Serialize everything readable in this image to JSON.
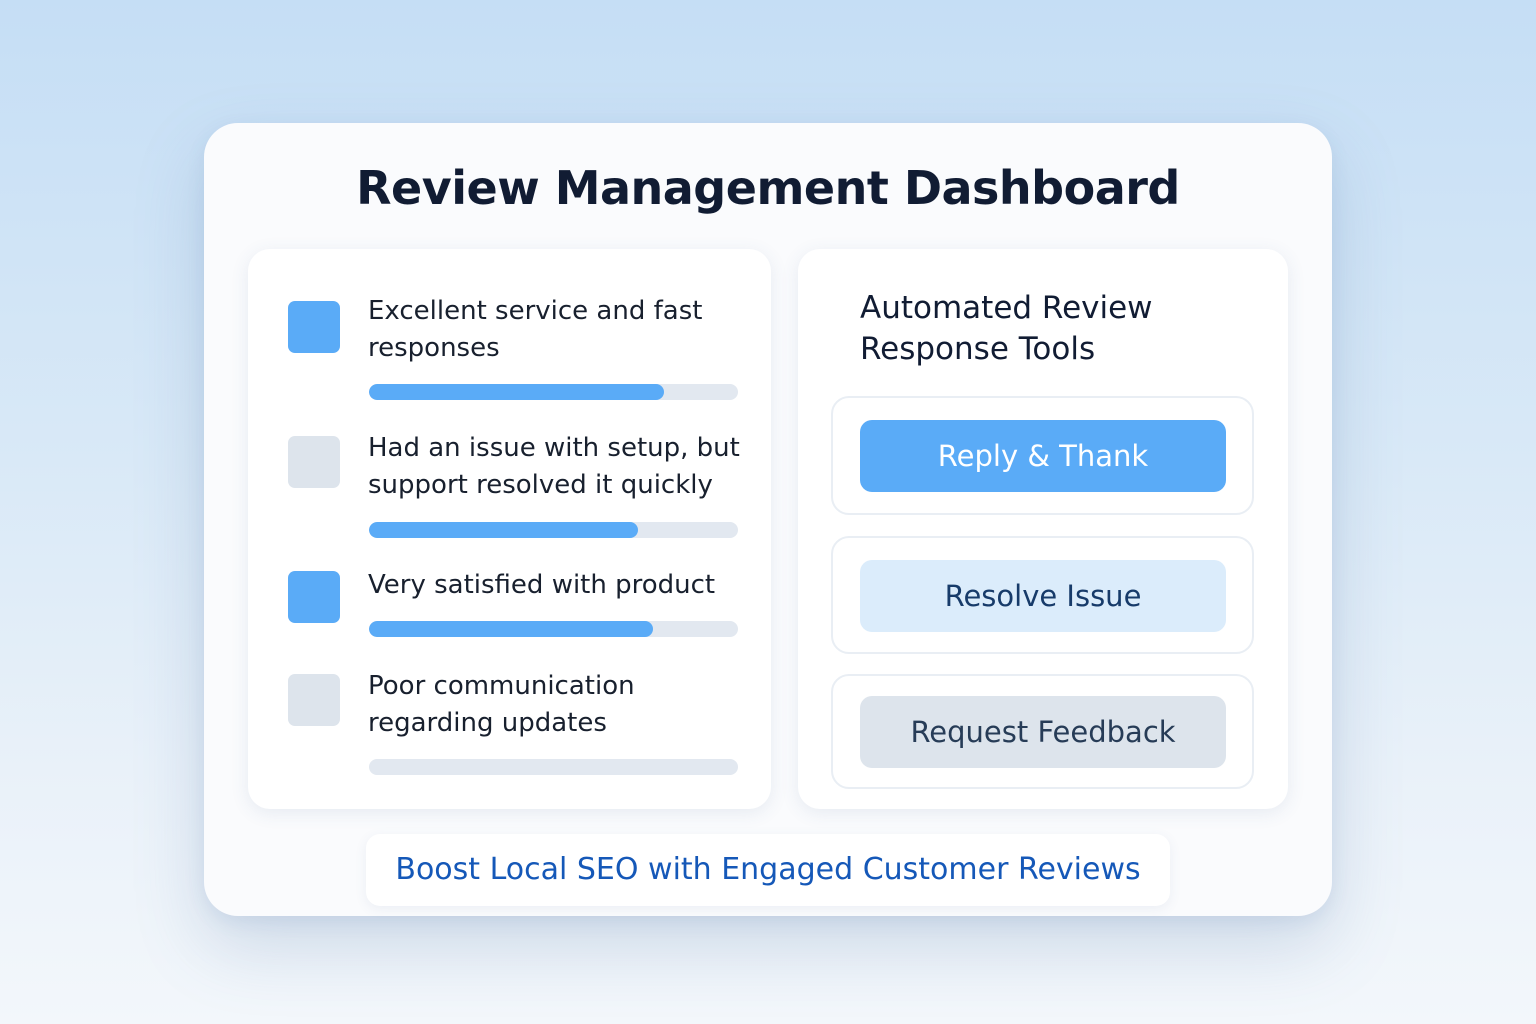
{
  "dashboard": {
    "title": "Review Management Dashboard"
  },
  "reviews": [
    {
      "text": "Excellent service and fast responses",
      "checked": true,
      "score": 0.8
    },
    {
      "text": "Had an issue with setup, but support resolved it quickly",
      "checked": false,
      "score": 0.73
    },
    {
      "text": "Very satisfied with product",
      "checked": true,
      "score": 0.77
    },
    {
      "text": "Poor communication regarding updates",
      "checked": false,
      "score": 0
    }
  ],
  "tools": {
    "title": "Automated Review Response Tools",
    "buttons": [
      {
        "label": "Reply & Thank",
        "style": "primary"
      },
      {
        "label": "Resolve Issue",
        "style": "soft"
      },
      {
        "label": "Request Feedback",
        "style": "muted"
      }
    ]
  },
  "tagline": "Boost Local SEO with Engaged Customer Reviews",
  "colors": {
    "accent": "#5aabf7",
    "unchecked": "#dde4ec",
    "tagline_text": "#1558b8"
  }
}
